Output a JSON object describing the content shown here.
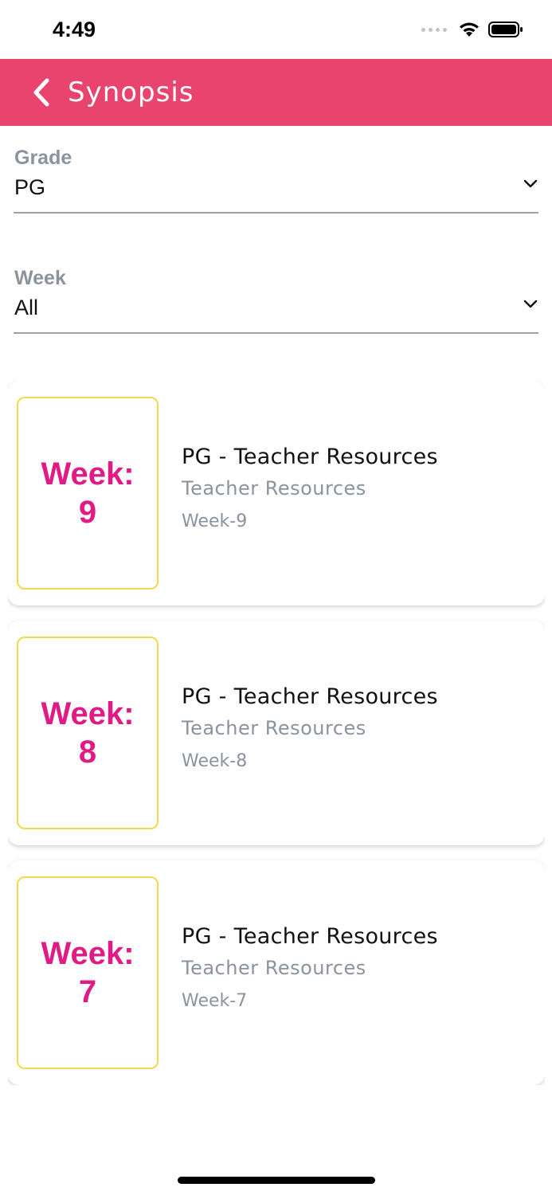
{
  "status": {
    "time": "4:49"
  },
  "header": {
    "title": "Synopsis",
    "back_icon": "chevron-left-icon",
    "background": "#e8446e"
  },
  "filters": {
    "grade": {
      "label": "Grade",
      "value": "PG"
    },
    "week": {
      "label": "Week",
      "value": "All"
    }
  },
  "cards": [
    {
      "thumb_line1": "Week:",
      "thumb_line2": "9",
      "title": "PG - Teacher Resources",
      "subtitle": "Teacher Resources",
      "week": "Week-9"
    },
    {
      "thumb_line1": "Week:",
      "thumb_line2": "8",
      "title": "PG - Teacher Resources",
      "subtitle": "Teacher Resources",
      "week": "Week-8"
    },
    {
      "thumb_line1": "Week:",
      "thumb_line2": "7",
      "title": "PG - Teacher Resources",
      "subtitle": "Teacher Resources",
      "week": "Week-7"
    }
  ],
  "colors": {
    "accent": "#e8446e",
    "thumb_text": "#e01b85",
    "thumb_border": "#f2d94e",
    "muted": "#8a939e"
  }
}
